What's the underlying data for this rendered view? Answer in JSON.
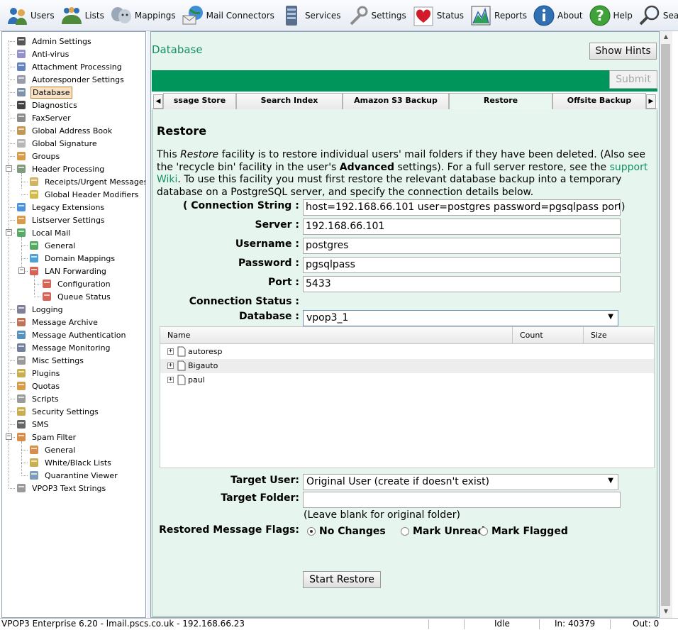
{
  "toolbar": [
    {
      "label": "Users",
      "icon": "users-icon"
    },
    {
      "label": "Lists",
      "icon": "lists-icon"
    },
    {
      "label": "Mappings",
      "icon": "mappings-icon"
    },
    {
      "label": "Mail Connectors",
      "icon": "mail-connectors-icon"
    },
    {
      "label": "Services",
      "icon": "services-icon"
    },
    {
      "label": "Settings",
      "icon": "settings-icon"
    },
    {
      "label": "Status",
      "icon": "status-icon"
    },
    {
      "label": "Reports",
      "icon": "reports-icon"
    },
    {
      "label": "About",
      "icon": "about-icon"
    },
    {
      "label": "Help",
      "icon": "help-icon"
    },
    {
      "label": "Search",
      "icon": "search-icon"
    }
  ],
  "sidebar": {
    "items": [
      {
        "label": "Admin Settings",
        "icon": "admin-icon"
      },
      {
        "label": "Anti-virus",
        "icon": "shield-icon"
      },
      {
        "label": "Attachment Processing",
        "icon": "paperclip-icon"
      },
      {
        "label": "Autoresponder Settings",
        "icon": "gear-icon"
      },
      {
        "label": "Database",
        "icon": "database-icon",
        "selected": true
      },
      {
        "label": "Diagnostics",
        "icon": "bug-icon"
      },
      {
        "label": "FaxServer",
        "icon": "fax-icon"
      },
      {
        "label": "Global Address Book",
        "icon": "address-book-icon"
      },
      {
        "label": "Global Signature",
        "icon": "document-icon"
      },
      {
        "label": "Groups",
        "icon": "groups-icon"
      },
      {
        "label": "Header Processing",
        "icon": "header-icon",
        "expanded": true
      },
      {
        "label": "Receipts/Urgent Messages",
        "icon": "receipt-icon"
      },
      {
        "label": "Global Header Modifiers",
        "icon": "pencil-icon"
      },
      {
        "label": "Legacy Extensions",
        "icon": "puzzle-icon"
      },
      {
        "label": "Listserver Settings",
        "icon": "people-icon"
      },
      {
        "label": "Local Mail",
        "icon": "gear-globe-icon",
        "expanded": true
      },
      {
        "label": "General",
        "icon": "gear-globe-icon"
      },
      {
        "label": "Domain Mappings",
        "icon": "globe-icon"
      },
      {
        "label": "LAN Forwarding",
        "icon": "network-icon",
        "expanded": true
      },
      {
        "label": "Configuration",
        "icon": "network-icon"
      },
      {
        "label": "Queue Status",
        "icon": "network-icon"
      },
      {
        "label": "Logging",
        "icon": "log-icon"
      },
      {
        "label": "Message Archive",
        "icon": "archive-icon"
      },
      {
        "label": "Message Authentication",
        "icon": "auth-icon"
      },
      {
        "label": "Message Monitoring",
        "icon": "monitor-icon"
      },
      {
        "label": "Misc Settings",
        "icon": "wrench-icon"
      },
      {
        "label": "Plugins",
        "icon": "plugin-icon"
      },
      {
        "label": "Quotas",
        "icon": "quota-icon"
      },
      {
        "label": "Scripts",
        "icon": "script-icon"
      },
      {
        "label": "Security Settings",
        "icon": "lock-icon"
      },
      {
        "label": "SMS",
        "icon": "phone-icon"
      },
      {
        "label": "Spam Filter",
        "icon": "spam-icon",
        "expanded": true
      },
      {
        "label": "General",
        "icon": "spam-icon"
      },
      {
        "label": "White/Black Lists",
        "icon": "list-icon"
      },
      {
        "label": "Quarantine Viewer",
        "icon": "magnifier-icon"
      },
      {
        "label": "VPOP3 Text Strings",
        "icon": "text-icon"
      }
    ]
  },
  "main": {
    "title": "Database",
    "show_hints": "Show Hints",
    "submit": "Submit",
    "tabs": [
      "ssage Store",
      "Search Index",
      "Amazon S3 Backup",
      "Restore",
      "Offsite Backup"
    ],
    "active_tab": "Restore",
    "heading": "Restore",
    "intro": {
      "p1": "This ",
      "em": "Restore",
      "p2": " facility is to restore individual users' mail folders if they have been deleted. (Also see the 'recycle bin' facility in the user's ",
      "strong": "Advanced",
      "p3": " settings). For a full server restore, see the ",
      "link": "support Wiki",
      "p4": ". To use this facility you must first restore the relevant database backup into a temporary database on a PostgreSQL server, and specify the connection details below."
    },
    "form": {
      "connection_string_open": "(",
      "connection_string_label": "Connection String :",
      "connection_string_value": "host=192.168.66.101 user=postgres password=pgsqlpass port",
      "connection_string_close": ")",
      "server_label": "Server :",
      "server_value": "192.168.66.101",
      "username_label": "Username :",
      "username_value": "postgres",
      "password_label": "Password :",
      "password_value": "pgsqlpass",
      "port_label": "Port :",
      "port_value": "5433",
      "status_label": "Connection Status :",
      "database_label": "Database :",
      "database_value": "vpop3_1"
    },
    "grid": {
      "columns": [
        "Name",
        "Count",
        "Size"
      ],
      "rows": [
        "autoresp",
        "Bigauto",
        "paul"
      ]
    },
    "target": {
      "user_label": "Target User:",
      "user_value": "Original User (create if doesn't exist)",
      "folder_label": "Target Folder:",
      "folder_value": "",
      "folder_hint": "(Leave blank for original folder)",
      "flags_label": "Restored Message Flags:",
      "flags": [
        "No Changes",
        "Mark Unread",
        "Mark Flagged"
      ],
      "flags_selected": 0,
      "start": "Start Restore"
    }
  },
  "status": {
    "product": "VPOP3 Enterprise 6.20 - lmail.pscs.co.uk - 192.168.66.23",
    "state": "Idle",
    "in": "In: 40379",
    "out": "Out: 0"
  },
  "colors": {
    "accent": "#00955a",
    "link": "#168f66",
    "panel_bg": "#e6f5ee"
  }
}
